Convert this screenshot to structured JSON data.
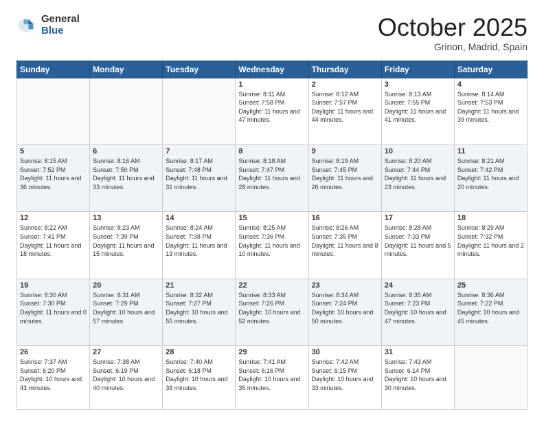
{
  "logo": {
    "general": "General",
    "blue": "Blue"
  },
  "header": {
    "month": "October 2025",
    "location": "Grinon, Madrid, Spain"
  },
  "weekdays": [
    "Sunday",
    "Monday",
    "Tuesday",
    "Wednesday",
    "Thursday",
    "Friday",
    "Saturday"
  ],
  "weeks": [
    [
      {
        "day": "",
        "info": ""
      },
      {
        "day": "",
        "info": ""
      },
      {
        "day": "",
        "info": ""
      },
      {
        "day": "1",
        "info": "Sunrise: 8:11 AM\nSunset: 7:58 PM\nDaylight: 11 hours and 47 minutes."
      },
      {
        "day": "2",
        "info": "Sunrise: 8:12 AM\nSunset: 7:57 PM\nDaylight: 11 hours and 44 minutes."
      },
      {
        "day": "3",
        "info": "Sunrise: 8:13 AM\nSunset: 7:55 PM\nDaylight: 11 hours and 41 minutes."
      },
      {
        "day": "4",
        "info": "Sunrise: 8:14 AM\nSunset: 7:53 PM\nDaylight: 11 hours and 39 minutes."
      }
    ],
    [
      {
        "day": "5",
        "info": "Sunrise: 8:15 AM\nSunset: 7:52 PM\nDaylight: 11 hours and 36 minutes."
      },
      {
        "day": "6",
        "info": "Sunrise: 8:16 AM\nSunset: 7:50 PM\nDaylight: 11 hours and 33 minutes."
      },
      {
        "day": "7",
        "info": "Sunrise: 8:17 AM\nSunset: 7:48 PM\nDaylight: 11 hours and 31 minutes."
      },
      {
        "day": "8",
        "info": "Sunrise: 8:18 AM\nSunset: 7:47 PM\nDaylight: 11 hours and 28 minutes."
      },
      {
        "day": "9",
        "info": "Sunrise: 8:19 AM\nSunset: 7:45 PM\nDaylight: 11 hours and 26 minutes."
      },
      {
        "day": "10",
        "info": "Sunrise: 8:20 AM\nSunset: 7:44 PM\nDaylight: 11 hours and 23 minutes."
      },
      {
        "day": "11",
        "info": "Sunrise: 8:21 AM\nSunset: 7:42 PM\nDaylight: 11 hours and 20 minutes."
      }
    ],
    [
      {
        "day": "12",
        "info": "Sunrise: 8:22 AM\nSunset: 7:41 PM\nDaylight: 11 hours and 18 minutes."
      },
      {
        "day": "13",
        "info": "Sunrise: 8:23 AM\nSunset: 7:39 PM\nDaylight: 11 hours and 15 minutes."
      },
      {
        "day": "14",
        "info": "Sunrise: 8:24 AM\nSunset: 7:38 PM\nDaylight: 11 hours and 13 minutes."
      },
      {
        "day": "15",
        "info": "Sunrise: 8:25 AM\nSunset: 7:36 PM\nDaylight: 11 hours and 10 minutes."
      },
      {
        "day": "16",
        "info": "Sunrise: 8:26 AM\nSunset: 7:35 PM\nDaylight: 11 hours and 8 minutes."
      },
      {
        "day": "17",
        "info": "Sunrise: 8:28 AM\nSunset: 7:33 PM\nDaylight: 11 hours and 5 minutes."
      },
      {
        "day": "18",
        "info": "Sunrise: 8:29 AM\nSunset: 7:32 PM\nDaylight: 11 hours and 2 minutes."
      }
    ],
    [
      {
        "day": "19",
        "info": "Sunrise: 8:30 AM\nSunset: 7:30 PM\nDaylight: 11 hours and 0 minutes."
      },
      {
        "day": "20",
        "info": "Sunrise: 8:31 AM\nSunset: 7:29 PM\nDaylight: 10 hours and 57 minutes."
      },
      {
        "day": "21",
        "info": "Sunrise: 8:32 AM\nSunset: 7:27 PM\nDaylight: 10 hours and 55 minutes."
      },
      {
        "day": "22",
        "info": "Sunrise: 8:33 AM\nSunset: 7:26 PM\nDaylight: 10 hours and 52 minutes."
      },
      {
        "day": "23",
        "info": "Sunrise: 8:34 AM\nSunset: 7:24 PM\nDaylight: 10 hours and 50 minutes."
      },
      {
        "day": "24",
        "info": "Sunrise: 8:35 AM\nSunset: 7:23 PM\nDaylight: 10 hours and 47 minutes."
      },
      {
        "day": "25",
        "info": "Sunrise: 8:36 AM\nSunset: 7:22 PM\nDaylight: 10 hours and 45 minutes."
      }
    ],
    [
      {
        "day": "26",
        "info": "Sunrise: 7:37 AM\nSunset: 6:20 PM\nDaylight: 10 hours and 43 minutes."
      },
      {
        "day": "27",
        "info": "Sunrise: 7:38 AM\nSunset: 6:19 PM\nDaylight: 10 hours and 40 minutes."
      },
      {
        "day": "28",
        "info": "Sunrise: 7:40 AM\nSunset: 6:18 PM\nDaylight: 10 hours and 38 minutes."
      },
      {
        "day": "29",
        "info": "Sunrise: 7:41 AM\nSunset: 6:16 PM\nDaylight: 10 hours and 35 minutes."
      },
      {
        "day": "30",
        "info": "Sunrise: 7:42 AM\nSunset: 6:15 PM\nDaylight: 10 hours and 33 minutes."
      },
      {
        "day": "31",
        "info": "Sunrise: 7:43 AM\nSunset: 6:14 PM\nDaylight: 10 hours and 30 minutes."
      },
      {
        "day": "",
        "info": ""
      }
    ]
  ]
}
